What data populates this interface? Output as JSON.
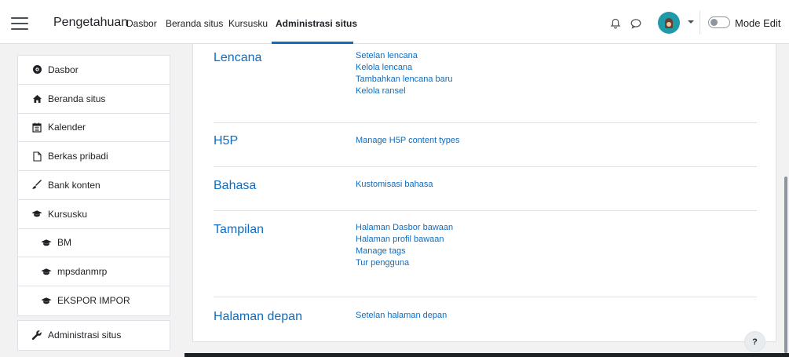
{
  "navbar": {
    "brand": "Pengetahuan",
    "links": [
      {
        "label": "Dasbor",
        "active": false
      },
      {
        "label": "Beranda situs",
        "active": false
      },
      {
        "label": "Kursusku",
        "active": false
      },
      {
        "label": "Administrasi situs",
        "active": true
      }
    ],
    "mode_label": "Mode Edit",
    "accent": "#0f6cbf"
  },
  "sidebar": {
    "items": [
      {
        "label": "Dasbor",
        "icon": "dashboard-icon"
      },
      {
        "label": "Beranda situs",
        "icon": "home-icon"
      },
      {
        "label": "Kalender",
        "icon": "calendar-icon"
      },
      {
        "label": "Berkas pribadi",
        "icon": "file-icon"
      },
      {
        "label": "Bank konten",
        "icon": "paintbrush-icon"
      },
      {
        "label": "Kursusku",
        "icon": "graduation-cap-icon"
      },
      {
        "label": "BM",
        "icon": "graduation-cap-icon"
      },
      {
        "label": "mpsdanmrp",
        "icon": "graduation-cap-icon"
      },
      {
        "label": "EKSPOR IMPOR",
        "icon": "graduation-cap-icon"
      }
    ],
    "admin": {
      "label": "Administrasi situs",
      "icon": "wrench-icon"
    }
  },
  "sections": [
    {
      "title": "Lencana",
      "links": [
        "Setelan lencana",
        "Kelola lencana",
        "Tambahkan lencana baru",
        "Kelola ransel"
      ]
    },
    {
      "title": "H5P",
      "links": [
        "Manage H5P content types"
      ]
    },
    {
      "title": "Bahasa",
      "links": [
        "Kustomisasi bahasa"
      ]
    },
    {
      "title": "Tampilan",
      "links": [
        "Halaman Dasbor bawaan",
        "Halaman profil bawaan",
        "Manage tags",
        "Tur pengguna"
      ]
    },
    {
      "title": "Halaman depan",
      "links": [
        "Setelan halaman depan"
      ]
    }
  ],
  "help_label": "?"
}
